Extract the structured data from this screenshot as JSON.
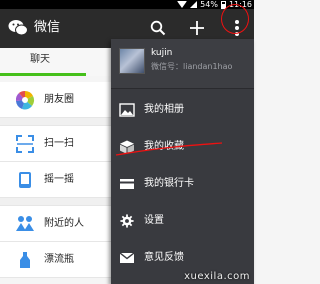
{
  "statusbar": {
    "battery": "54%",
    "time": "11:16"
  },
  "header": {
    "title": "微信"
  },
  "tabs": [
    {
      "label": "聊天"
    }
  ],
  "discover": {
    "items": [
      {
        "label": "朋友圈"
      },
      {
        "label": "扫一扫"
      },
      {
        "label": "摇一摇"
      },
      {
        "label": "附近的人"
      },
      {
        "label": "漂流瓶"
      }
    ]
  },
  "menu": {
    "profile": {
      "name": "kujin",
      "wechat_id": "微信号：liandan1hao"
    },
    "items": [
      {
        "label": "我的相册",
        "icon": "photo-icon"
      },
      {
        "label": "我的收藏",
        "icon": "favorites-cube-icon"
      },
      {
        "label": "我的银行卡",
        "icon": "bank-card-icon"
      },
      {
        "label": "设置",
        "icon": "gear-icon"
      },
      {
        "label": "意见反馈",
        "icon": "mail-icon"
      }
    ]
  },
  "watermark": "xuexila.com",
  "colors": {
    "titlebar": "#2b2b2b",
    "menu": "#393a3f",
    "accent": "#45c01a",
    "annotation": "#e11111"
  }
}
